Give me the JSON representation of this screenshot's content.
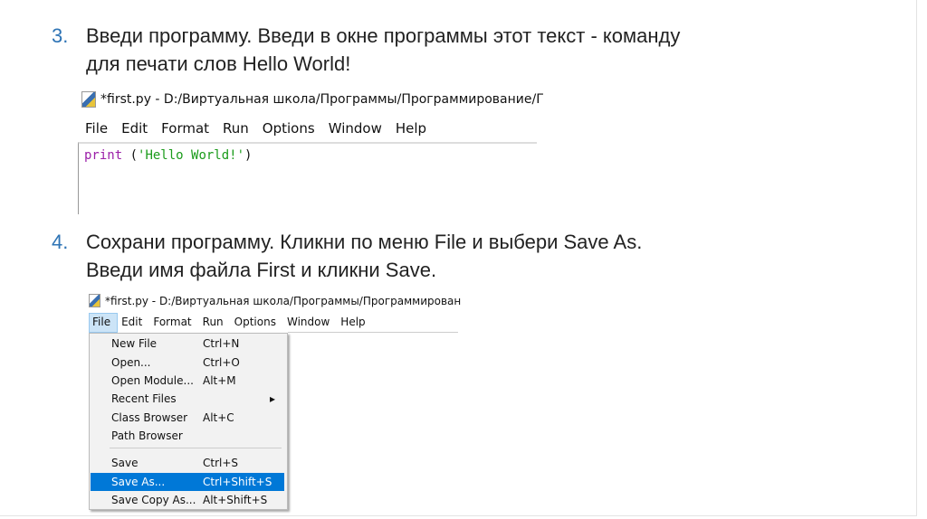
{
  "steps": [
    {
      "number": "3.",
      "lines": [
        "Введи программу. Введи в окне программы этот текст - команду",
        "для печати слов Hello World!"
      ]
    },
    {
      "number": "4.",
      "lines": [
        "Сохрани программу. Кликни по меню File и выбери Save As.",
        "Введи имя файла First и кликни Save."
      ]
    }
  ],
  "shot1": {
    "title": "*first.py - D:/Виртуальная школа/Программы/Программирование/Г",
    "menu": [
      "File",
      "Edit",
      "Format",
      "Run",
      "Options",
      "Window",
      "Help"
    ],
    "code": {
      "keyword": "print",
      "open": " (",
      "string": "'Hello World!'",
      "close": ")"
    }
  },
  "shot2": {
    "title": "*first.py - D:/Виртуальная школа/Программы/Программирован",
    "menu": [
      "File",
      "Edit",
      "Format",
      "Run",
      "Options",
      "Window",
      "Help"
    ],
    "items": [
      {
        "label": "New File",
        "shortcut": "Ctrl+N"
      },
      {
        "label": "Open...",
        "shortcut": "Ctrl+O"
      },
      {
        "label": "Open Module...",
        "shortcut": "Alt+M"
      },
      {
        "label": "Recent Files",
        "shortcut": "▸"
      },
      {
        "label": "Class Browser",
        "shortcut": "Alt+C"
      },
      {
        "label": "Path Browser",
        "shortcut": ""
      },
      {
        "label": "Save",
        "shortcut": "Ctrl+S"
      },
      {
        "label": "Save As...",
        "shortcut": "Ctrl+Shift+S"
      },
      {
        "label": "Save Copy As...",
        "shortcut": "Alt+Shift+S"
      }
    ]
  },
  "colors": {
    "accent": "#2e74b5",
    "highlight": "#0078d7",
    "keyword": "#9b1fa8",
    "string": "#1a9b1a"
  }
}
